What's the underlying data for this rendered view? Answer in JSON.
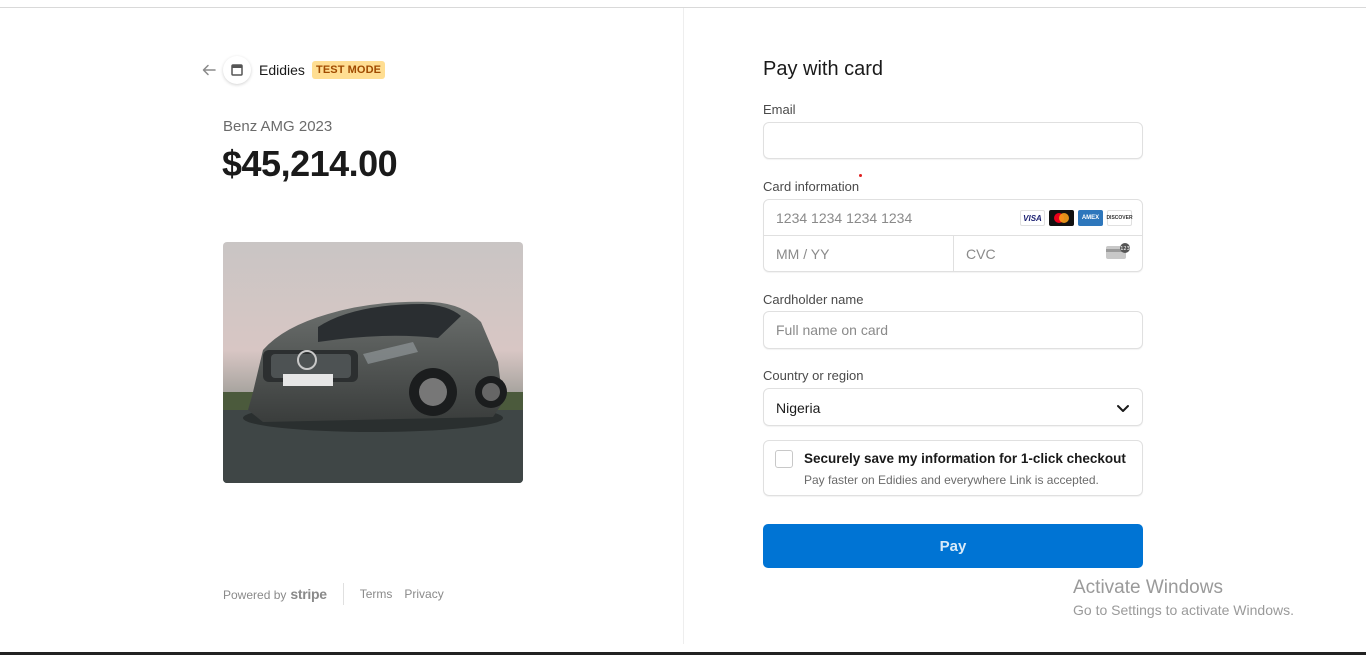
{
  "merchant": {
    "name": "Edidies",
    "badge": "TEST MODE",
    "back_icon": "arrow-left-icon",
    "store_icon": "storefront-icon"
  },
  "product": {
    "name": "Benz AMG 2023",
    "price": "$45,214.00",
    "image_subject": "Mercedes-Benz A-Class car"
  },
  "footer": {
    "powered_by": "Powered by",
    "brand": "stripe",
    "terms": "Terms",
    "privacy": "Privacy"
  },
  "form": {
    "title": "Pay with card",
    "email_label": "Email",
    "email_value": "",
    "card_label": "Card information",
    "card_number_placeholder": "1234 1234 1234 1234",
    "expiry_placeholder": "MM / YY",
    "cvc_placeholder": "CVC",
    "card_brands": [
      "VISA",
      "Mastercard",
      "AMEX",
      "DISCOVER"
    ],
    "cardholder_label": "Cardholder name",
    "cardholder_placeholder": "Full name on card",
    "country_label": "Country or region",
    "country_value": "Nigeria",
    "save_title": "Securely save my information for 1-click checkout",
    "save_subtitle": "Pay faster on Edidies and everywhere Link is accepted.",
    "pay_label": "Pay"
  },
  "watermark": {
    "line1": "Activate Windows",
    "line2": "Go to Settings to activate Windows."
  },
  "colors": {
    "accent": "#0074d4",
    "badge_bg": "#ffde92",
    "badge_text": "#a04b00"
  }
}
